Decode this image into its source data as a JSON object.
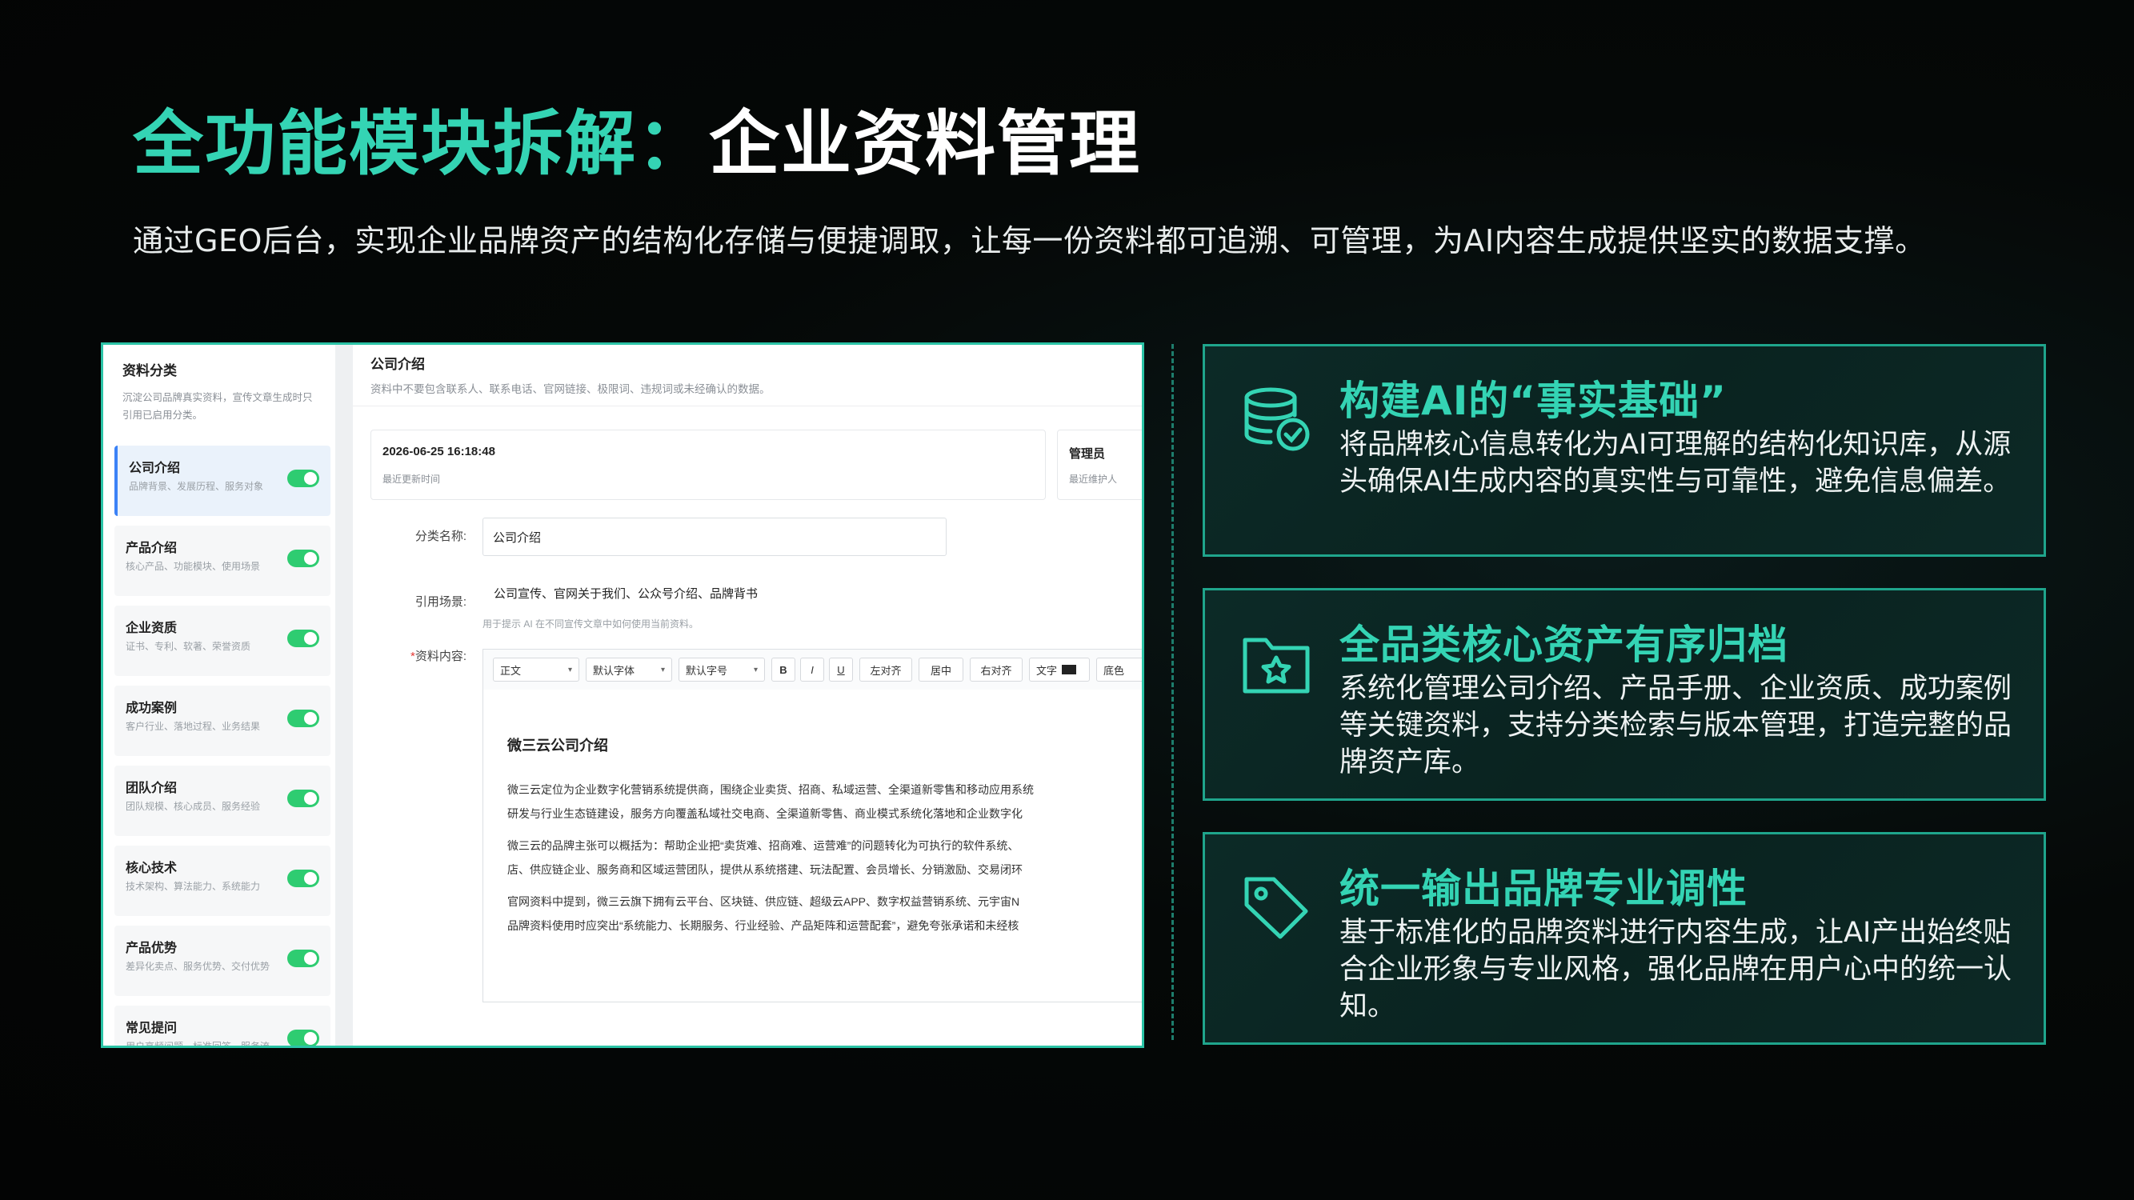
{
  "header": {
    "title_highlight": "全功能模块拆解：",
    "title_rest": "企业资料管理",
    "subtitle": "通过GEO后台，实现企业品牌资产的结构化存储与便捷调取，让每一份资料都可追溯、可管理，为AI内容生成提供坚实的数据支撑。"
  },
  "screenshot": {
    "sidebar": {
      "title": "资料分类",
      "desc_line1": "沉淀公司品牌真实资料，宣传文章生成时只",
      "desc_line2": "引用已启用分类。",
      "items": [
        {
          "name": "公司介绍",
          "desc": "品牌背景、发展历程、服务对象",
          "enabled": true,
          "active": true
        },
        {
          "name": "产品介绍",
          "desc": "核心产品、功能模块、使用场景",
          "enabled": true,
          "active": false
        },
        {
          "name": "企业资质",
          "desc": "证书、专利、软著、荣誉资质",
          "enabled": true,
          "active": false
        },
        {
          "name": "成功案例",
          "desc": "客户行业、落地过程、业务结果",
          "enabled": true,
          "active": false
        },
        {
          "name": "团队介绍",
          "desc": "团队规模、核心成员、服务经验",
          "enabled": true,
          "active": false
        },
        {
          "name": "核心技术",
          "desc": "技术架构、算法能力、系统能力",
          "enabled": true,
          "active": false
        },
        {
          "name": "产品优势",
          "desc": "差异化卖点、服务优势、交付优势",
          "enabled": true,
          "active": false
        },
        {
          "name": "常见提问",
          "desc": "用户高频问题、标准回答、服务流程",
          "enabled": true,
          "active": false
        }
      ]
    },
    "main": {
      "title": "公司介绍",
      "desc": "资料中不要包含联系人、联系电话、官网链接、极限词、违规词或未经确认的数据。",
      "updated_time": "2026-06-25 16:18:48",
      "updated_label": "最近更新时间",
      "maintainer": "管理员",
      "maintainer_label": "最近维护人",
      "form": {
        "name_label": "分类名称:",
        "name_value": "公司介绍",
        "scene_label": "引用场景:",
        "scene_value": "公司宣传、官网关于我们、公众号介绍、品牌背书",
        "scene_hint": "用于提示 AI 在不同宣传文章中如何使用当前资料。",
        "content_label": "资料内容:",
        "content_required": "*"
      },
      "toolbar": {
        "paragraph": "正文",
        "font": "默认字体",
        "size": "默认字号",
        "bold": "B",
        "italic": "I",
        "underline": "U",
        "align_left": "左对齐",
        "align_center": "居中",
        "align_right": "右对齐",
        "text_color": "文字",
        "bg_color": "底色"
      },
      "doc": {
        "title": "微三云公司介绍",
        "p1_l1": "微三云定位为企业数字化营销系统提供商，围绕企业卖货、招商、私域运营、全渠道新零售和移动应用系统",
        "p1_l2": "研发与行业生态链建设，服务方向覆盖私域社交电商、全渠道新零售、商业模式系统化落地和企业数字化",
        "p2_l1": "微三云的品牌主张可以概括为：帮助企业把“卖货难、招商难、运营难”的问题转化为可执行的软件系统、",
        "p2_l2": "店、供应链企业、服务商和区域运营团队，提供从系统搭建、玩法配置、会员增长、分销激励、交易闭环",
        "p3_l1": "官网资料中提到，微三云旗下拥有云平台、区块链、供应链、超级云APP、数字权益营销系统、元宇宙N",
        "p3_l2": "品牌资料使用时应突出“系统能力、长期服务、行业经验、产品矩阵和运营配套”，避免夸张承诺和未经核"
      }
    }
  },
  "cards": [
    {
      "icon": "database-check-icon",
      "title": "构建AI的“事实基础”",
      "body": "将品牌核心信息转化为AI可理解的结构化知识库，从源头确保AI生成内容的真实性与可靠性，避免信息偏差。"
    },
    {
      "icon": "folder-star-icon",
      "title": "全品类核心资产有序归档",
      "body": "系统化管理公司介绍、产品手册、企业资质、成功案例等关键资料，支持分类检索与版本管理，打造完整的品牌资产库。"
    },
    {
      "icon": "tag-icon",
      "title": "统一输出品牌专业调性",
      "body": "基于标准化的品牌资料进行内容生成，让AI产出始终贴合企业形象与专业风格，强化品牌在用户心中的统一认知。"
    }
  ],
  "colors": {
    "accent": "#34d4b4",
    "card_border": "#1fa58c",
    "background": "#050807",
    "toggle_on": "#2ecc71"
  }
}
